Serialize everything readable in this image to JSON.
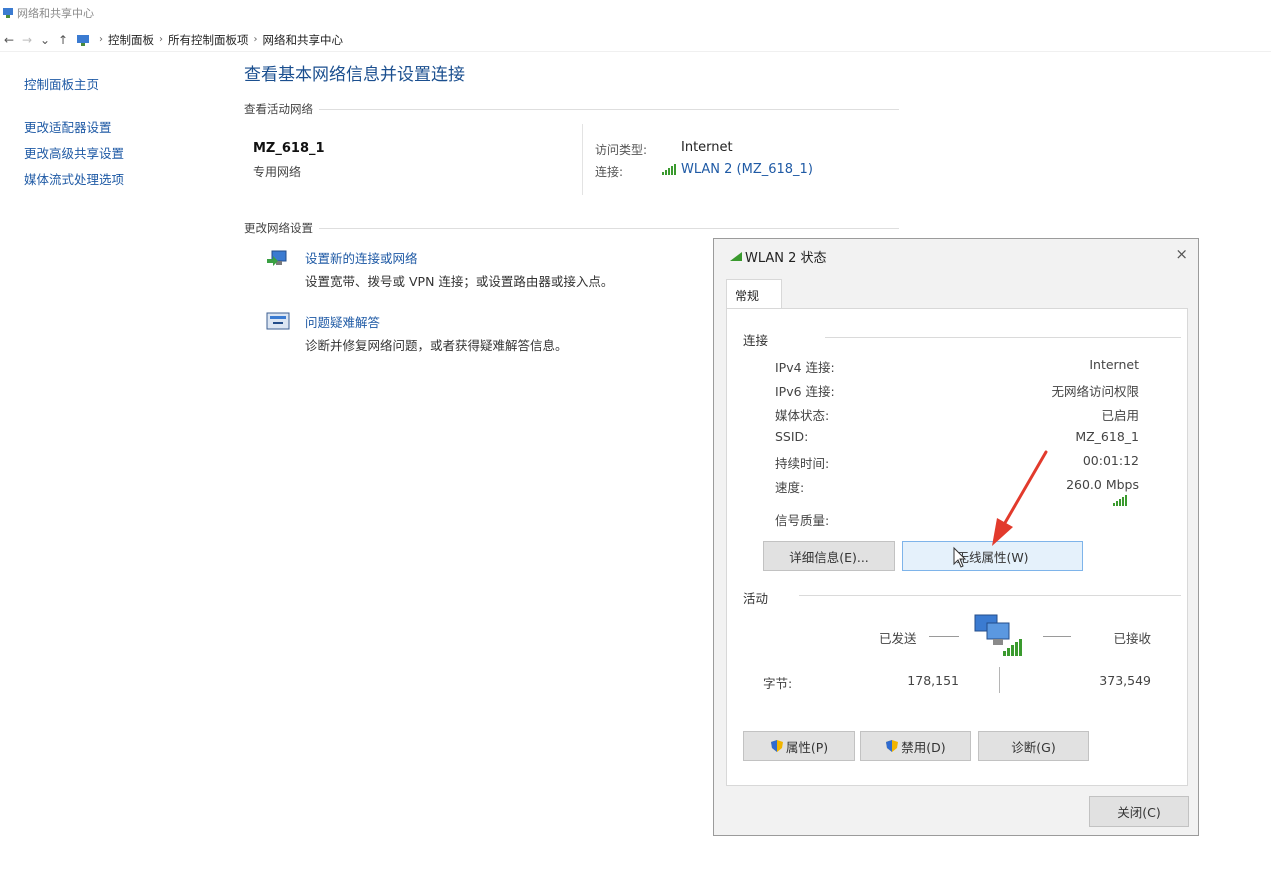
{
  "window": {
    "title": "网络和共享中心"
  },
  "address": {
    "back": "←",
    "forward": "→",
    "recent": "⌄",
    "up": "↑",
    "crumbs": [
      "控制面板",
      "所有控制面板项",
      "网络和共享中心"
    ]
  },
  "sidebar": {
    "home": "控制面板主页",
    "items": [
      "更改适配器设置",
      "更改高级共享设置",
      "媒体流式处理选项"
    ]
  },
  "main": {
    "title": "查看基本网络信息并设置连接",
    "active_section": "查看活动网络",
    "network_name": "MZ_618_1",
    "network_type": "专用网络",
    "access_label": "访问类型:",
    "access_value": "Internet",
    "conn_label": "连接:",
    "conn_value": "WLAN 2 (MZ_618_1)",
    "change_section": "更改网络设置",
    "task1_link": "设置新的连接或网络",
    "task1_desc": "设置宽带、拨号或 VPN 连接；或设置路由器或接入点。",
    "task2_link": "问题疑难解答",
    "task2_desc": "诊断并修复网络问题，或者获得疑难解答信息。"
  },
  "dialog": {
    "title": "WLAN 2 状态",
    "close": "×",
    "tab": "常规",
    "conn_group": "连接",
    "rows": [
      {
        "label": "IPv4 连接:",
        "value": "Internet"
      },
      {
        "label": "IPv6 连接:",
        "value": "无网络访问权限"
      },
      {
        "label": "媒体状态:",
        "value": "已启用"
      },
      {
        "label": "SSID:",
        "value": "MZ_618_1"
      },
      {
        "label": "持续时间:",
        "value": "00:01:12"
      },
      {
        "label": "速度:",
        "value": "260.0 Mbps"
      }
    ],
    "signal_label": "信号质量:",
    "details_btn": "详细信息(E)...",
    "wireless_btn": "无线属性(W)",
    "activity_group": "活动",
    "sent_label": "已发送",
    "recv_label": "已接收",
    "bytes_label": "字节:",
    "bytes_sent": "178,151",
    "bytes_recv": "373,549",
    "props_btn": "属性(P)",
    "disable_btn": "禁用(D)",
    "diagnose_btn": "诊断(G)",
    "close_btn": "关闭(C)"
  },
  "colors": {
    "link": "#1f5aa5",
    "arrow": "#e23a2c",
    "signal": "#3a9a2e"
  }
}
